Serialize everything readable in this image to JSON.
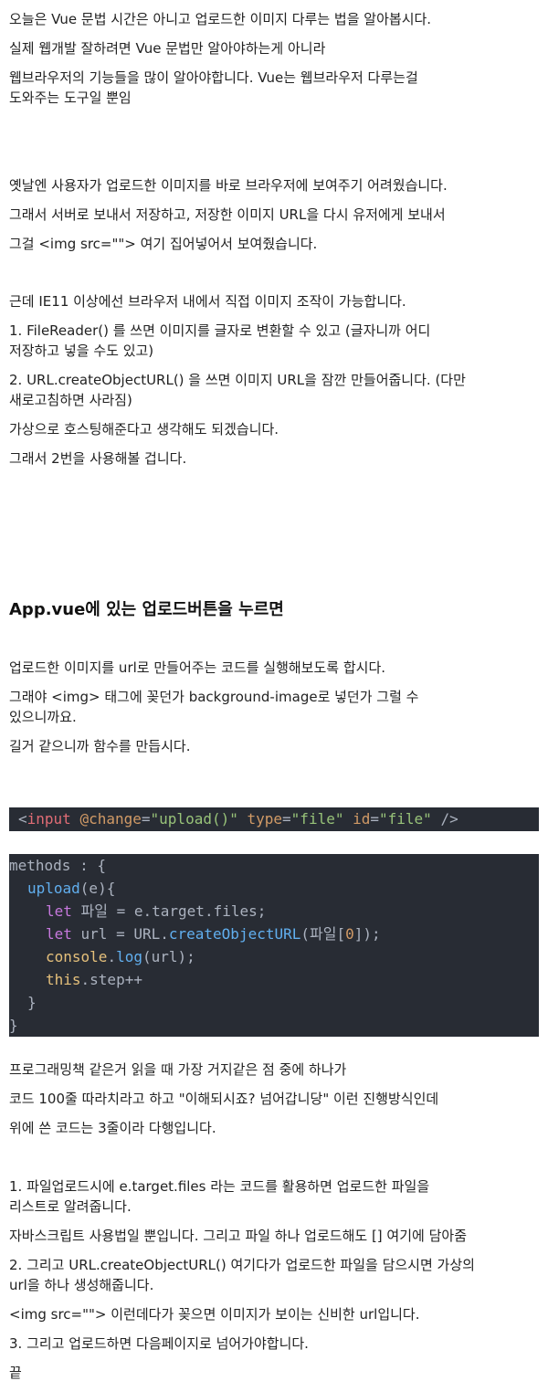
{
  "intro": {
    "l1": "오늘은 Vue 문법 시간은 아니고 업로드한 이미지 다루는 법을 알아봅시다.",
    "l2": "실제 웹개발 잘하려면 Vue 문법만 알아야하는게 아니라",
    "l3": "웹브라우저의 기능들을 많이 알아야합니다. Vue는 웹브라우저 다루는걸",
    "l4": "도와주는 도구일 뿐임"
  },
  "history": {
    "l1": "옛날엔 사용자가 업로드한 이미지를 바로 브라우저에 보여주기 어려웠습니다.",
    "l2": "그래서 서버로 보내서 저장하고, 저장한 이미지 URL을 다시 유저에게 보내서",
    "l3": "그걸 <img src=\"\"> 여기 집어넣어서 보여줬습니다."
  },
  "modern": {
    "l1": "근데 IE11 이상에선 브라우저 내에서 직접 이미지 조작이 가능합니다.",
    "l2": "1. FileReader() 를 쓰면 이미지를 글자로 변환할 수 있고 (글자니까 어디",
    "l3": "저장하고 넣을 수도 있고)",
    "l4": "2. URL.createObjectURL() 을 쓰면 이미지 URL을 잠깐 만들어줍니다. (다만",
    "l5": "새로고침하면 사라짐)",
    "l6": "가상으로 호스팅해준다고 생각해도 되겠습니다.",
    "l7": "그래서 2번을 사용해볼 겁니다."
  },
  "heading": "App.vue에 있는 업로드버튼을 누르면",
  "section": {
    "l1": "업로드한 이미지를 url로 만들어주는 코드를 실행해보도록 합시다.",
    "l2": "그래야 <img> 태그에 꽂던가 background-image로 넣던가 그럴 수",
    "l3": "있으니까요.",
    "l4": "길거 같으니까 함수를 만듭시다."
  },
  "code1": {
    "lt": "<",
    "tag": "input",
    "a1": "@change",
    "eq1": "=",
    "v1": "\"upload()\"",
    "a2": "type",
    "eq2": "=",
    "v2": "\"file\"",
    "a3": "id",
    "eq3": "=",
    "v3": "\"file\"",
    "end": " />"
  },
  "code2": {
    "l1": "methods : {",
    "l2_fn": "upload",
    "l2_rest": "(e){",
    "l3_kw": "let",
    "l3_rest": " 파일 = e.target.files;",
    "l4_kw": "let",
    "l4_a": " url = URL.",
    "l4_fn": "createObjectURL",
    "l4_b": "(파일[",
    "l4_num": "0",
    "l4_c": "]);",
    "l5_obj": "console",
    "l5_dot": ".",
    "l5_fn": "log",
    "l5_rest": "(url);",
    "l6_kw": "this",
    "l6_rest": ".step++",
    "l7": "}",
    "l8": "}"
  },
  "after": {
    "l1": "프로그래밍책 같은거 읽을 때 가장 거지같은 점 중에 하나가",
    "l2": "코드 100줄 따라치라고 하고 \"이해되시죠? 넘어갑니당\" 이런 진행방식인데",
    "l3": "위에 쓴 코드는 3줄이라 다행입니다."
  },
  "explain": {
    "l1": "1. 파일업로드시에 e.target.files 라는 코드를 활용하면 업로드한 파일을",
    "l2": "리스트로 알려줍니다.",
    "l3": "자바스크립트 사용법일 뿐입니다. 그리고 파일 하나 업로드해도 [] 여기에 담아줌",
    "l4": "2. 그리고 URL.createObjectURL() 여기다가 업로드한 파일을 담으시면 가상의",
    "l5": "url을 하나 생성해줍니다.",
    "l6": "<img src=\"\"> 이런데다가 꽂으면 이미지가 보이는 신비한 url입니다.",
    "l7": "3. 그리고 업로드하면 다음페이지로 넘어가야합니다.",
    "l8": "끝"
  }
}
